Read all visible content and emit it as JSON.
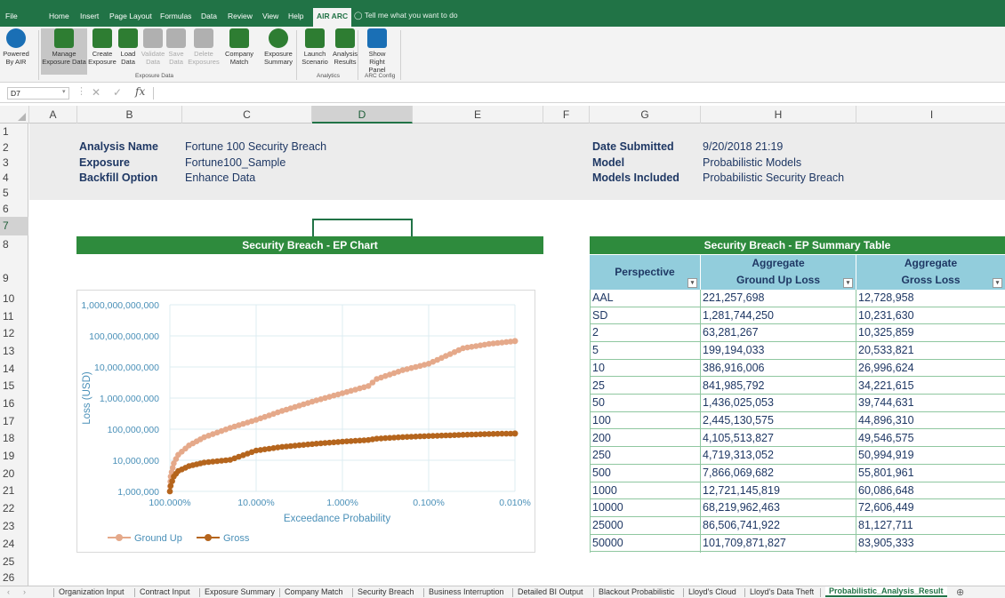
{
  "ribbon_tabs": [
    "File",
    "Home",
    "Insert",
    "Page Layout",
    "Formulas",
    "Data",
    "Review",
    "View",
    "Help",
    "AIR ARC"
  ],
  "active_tab": "AIR ARC",
  "tell_me": "Tell me what you want to do",
  "ribbon": {
    "buttons": [
      {
        "label1": "Powered",
        "label2": "By AIR",
        "color": "#1a6fb5",
        "icon": "check-badge-icon"
      },
      {
        "label1": "Manage",
        "label2": "Exposure Data",
        "color": "#2e7d32",
        "icon": "database-icon"
      },
      {
        "label1": "Create",
        "label2": "Exposure",
        "color": "#2e7d32",
        "icon": "document-icon"
      },
      {
        "label1": "Load",
        "label2": "Data",
        "color": "#2e7d32",
        "icon": "load-icon"
      },
      {
        "label1": "Validate",
        "label2": "Data",
        "color": "#b0b0b0",
        "icon": "validate-icon"
      },
      {
        "label1": "Save",
        "label2": "Data",
        "color": "#b0b0b0",
        "icon": "save-icon"
      },
      {
        "label1": "Delete",
        "label2": "Exposures",
        "color": "#b0b0b0",
        "icon": "trash-icon"
      },
      {
        "label1": "Company",
        "label2": "Match",
        "color": "#2e7d32",
        "icon": "company-match-icon"
      },
      {
        "label1": "Exposure",
        "label2": "Summary",
        "color": "#2e7d32",
        "icon": "pie-chart-icon"
      },
      {
        "label1": "Launch",
        "label2": "Scenario",
        "color": "#2e7d32",
        "icon": "rocket-icon"
      },
      {
        "label1": "Analysis",
        "label2": "Results",
        "color": "#2e7d32",
        "icon": "analysis-icon"
      },
      {
        "label1": "Show",
        "label2": "Right Panel",
        "color": "#1a6fb5",
        "icon": "panel-icon"
      }
    ],
    "groups": [
      "Exposure Data",
      "Analytics",
      "ARC Config"
    ]
  },
  "formula_bar": {
    "name_box": "D7",
    "fx": "fx",
    "content": ""
  },
  "columns": [
    "A",
    "B",
    "C",
    "D",
    "E",
    "F",
    "G",
    "H",
    "I"
  ],
  "rows": [
    "1",
    "2",
    "3",
    "4",
    "5",
    "6",
    "7",
    "8",
    "9",
    "10",
    "11",
    "12",
    "13",
    "14",
    "15",
    "16",
    "17",
    "18",
    "19",
    "20",
    "21",
    "22",
    "23",
    "24",
    "25",
    "26"
  ],
  "info_left": [
    {
      "label": "Analysis Name",
      "value": "Fortune 100 Security Breach"
    },
    {
      "label": "Exposure",
      "value": "Fortune100_Sample"
    },
    {
      "label": "Backfill Option",
      "value": "Enhance Data"
    }
  ],
  "info_right": [
    {
      "label": "Date Submitted",
      "value": "9/20/2018 21:19"
    },
    {
      "label": "Model",
      "value": "Probabilistic Models"
    },
    {
      "label": "Models Included",
      "value": "Probabilistic Security Breach"
    }
  ],
  "chart_title_bar": "Security Breach - EP Chart",
  "table": {
    "title": "Security Breach - EP Summary Table",
    "headers": [
      {
        "line1": "",
        "line2": "Perspective"
      },
      {
        "line1": "Aggregate",
        "line2": "Ground Up Loss"
      },
      {
        "line1": "Aggregate",
        "line2": "Gross Loss"
      }
    ],
    "rows": [
      [
        "AAL",
        "221,257,698",
        "12,728,958"
      ],
      [
        "SD",
        "1,281,744,250",
        "10,231,630"
      ],
      [
        "2",
        "63,281,267",
        "10,325,859"
      ],
      [
        "5",
        "199,194,033",
        "20,533,821"
      ],
      [
        "10",
        "386,916,006",
        "26,996,624"
      ],
      [
        "25",
        "841,985,792",
        "34,221,615"
      ],
      [
        "50",
        "1,436,025,053",
        "39,744,631"
      ],
      [
        "100",
        "2,445,130,575",
        "44,896,310"
      ],
      [
        "200",
        "4,105,513,827",
        "49,546,575"
      ],
      [
        "250",
        "4,719,313,052",
        "50,994,919"
      ],
      [
        "500",
        "7,866,069,682",
        "55,801,961"
      ],
      [
        "1000",
        "12,721,145,819",
        "60,086,648"
      ],
      [
        "10000",
        "68,219,962,463",
        "72,606,449"
      ],
      [
        "25000",
        "86,506,741,922",
        "81,127,711"
      ],
      [
        "50000",
        "101,709,871,827",
        "83,905,333"
      ]
    ]
  },
  "chart_data": {
    "type": "line",
    "xlabel": "Exceedance Probability",
    "ylabel": "Loss (USD)",
    "x_scale": "log-reversed",
    "y_scale": "log",
    "x_ticks": [
      "100.000%",
      "10.000%",
      "1.000%",
      "0.100%",
      "0.010%"
    ],
    "y_ticks": [
      "1,000,000",
      "10,000,000",
      "100,000,000",
      "1,000,000,000",
      "10,000,000,000",
      "100,000,000,000",
      "1,000,000,000,000"
    ],
    "ylim": [
      1000000,
      1000000000000
    ],
    "xlim": [
      1,
      0.0001
    ],
    "legend": "bottom-left",
    "grid": true,
    "series": [
      {
        "name": "Ground Up",
        "color": "#e5a98a",
        "x": [
          1,
          0.98,
          0.9,
          0.8,
          0.6,
          0.4,
          0.2,
          0.1,
          0.05,
          0.02,
          0.01,
          0.005,
          0.004,
          0.002,
          0.001,
          0.0004,
          0.0002,
          0.0001
        ],
        "y": [
          1000000,
          3000000,
          8000000,
          15000000,
          30000000,
          55000000,
          110000000,
          199194033,
          386916006,
          841985792,
          1436025053,
          2445130575,
          4105513827,
          7866069682,
          12721145819,
          40000000000,
          55000000000,
          68219962463
        ]
      },
      {
        "name": "Gross",
        "color": "#b5651d",
        "x": [
          1,
          0.98,
          0.9,
          0.8,
          0.6,
          0.4,
          0.2,
          0.1,
          0.05,
          0.02,
          0.01,
          0.005,
          0.004,
          0.002,
          0.001,
          0.0004,
          0.0002,
          0.0001
        ],
        "y": [
          1000000,
          1500000,
          3000000,
          4500000,
          6500000,
          8500000,
          10325859,
          20533821,
          26996624,
          34221615,
          39744631,
          44896310,
          49546575,
          55801961,
          60086648,
          66000000,
          70000000,
          72606449
        ]
      }
    ]
  },
  "sheet_tabs": [
    "Organization Input",
    "Contract Input",
    "Exposure Summary",
    "Company Match",
    "Security Breach",
    "Business Interruption",
    "Detailed BI Output",
    "Blackout Probabilistic",
    "Lloyd's Cloud",
    "Lloyd's Data Theft",
    "Probabilistic_Analysis_Result"
  ],
  "active_sheet": "Probabilistic_Analysis_Result",
  "theme": {
    "excel_green": "#217346",
    "header_fill": "#92cddc",
    "bar_green": "#2e8b3d",
    "ground_up": "#e5a98a",
    "gross": "#b5651d"
  }
}
